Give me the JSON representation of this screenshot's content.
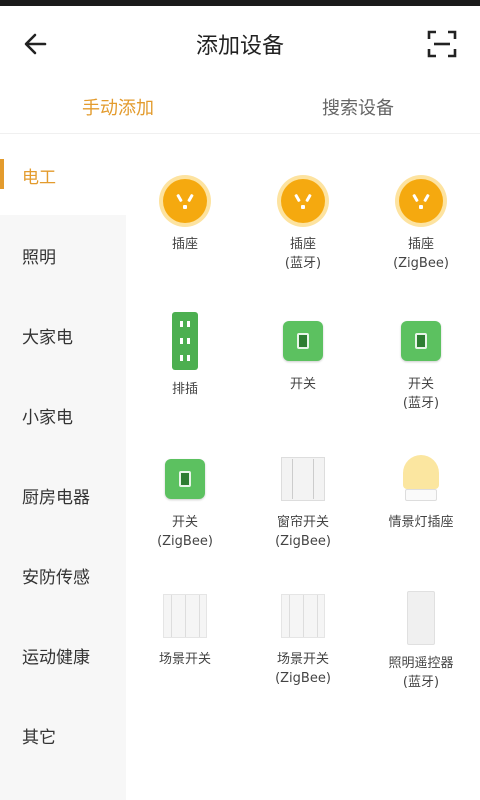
{
  "header": {
    "title": "添加设备",
    "back_icon": "arrow-left-icon",
    "scan_icon": "scan-icon"
  },
  "tabs": [
    {
      "label": "手动添加",
      "active": true
    },
    {
      "label": "搜索设备",
      "active": false
    }
  ],
  "sidebar": {
    "items": [
      {
        "label": "电工",
        "active": true
      },
      {
        "label": "照明"
      },
      {
        "label": "大家电"
      },
      {
        "label": "小家电"
      },
      {
        "label": "厨房电器"
      },
      {
        "label": "安防传感"
      },
      {
        "label": "运动健康"
      },
      {
        "label": "其它"
      }
    ]
  },
  "devices": [
    {
      "line1": "插座",
      "line2": "",
      "icon": "socket-icon"
    },
    {
      "line1": "插座",
      "line2": "(蓝牙)",
      "icon": "socket-icon"
    },
    {
      "line1": "插座",
      "line2": "(ZigBee)",
      "icon": "socket-icon"
    },
    {
      "line1": "排插",
      "line2": "",
      "icon": "power-strip-icon"
    },
    {
      "line1": "开关",
      "line2": "",
      "icon": "switch-icon"
    },
    {
      "line1": "开关",
      "line2": "(蓝牙)",
      "icon": "switch-icon"
    },
    {
      "line1": "开关",
      "line2": "(ZigBee)",
      "icon": "switch-icon"
    },
    {
      "line1": "窗帘开关",
      "line2": "(ZigBee)",
      "icon": "curtain-switch-icon"
    },
    {
      "line1": "情景灯插座",
      "line2": "",
      "icon": "lamp-icon"
    },
    {
      "line1": "场景开关",
      "line2": "",
      "icon": "scene-switch-icon"
    },
    {
      "line1": "场景开关",
      "line2": "(ZigBee)",
      "icon": "scene-switch-icon"
    },
    {
      "line1": "照明遥控器",
      "line2": "(蓝牙)",
      "icon": "remote-icon"
    }
  ],
  "colors": {
    "accent": "#e39b2d",
    "green": "#5cc160",
    "socket": "#f5a90f"
  }
}
